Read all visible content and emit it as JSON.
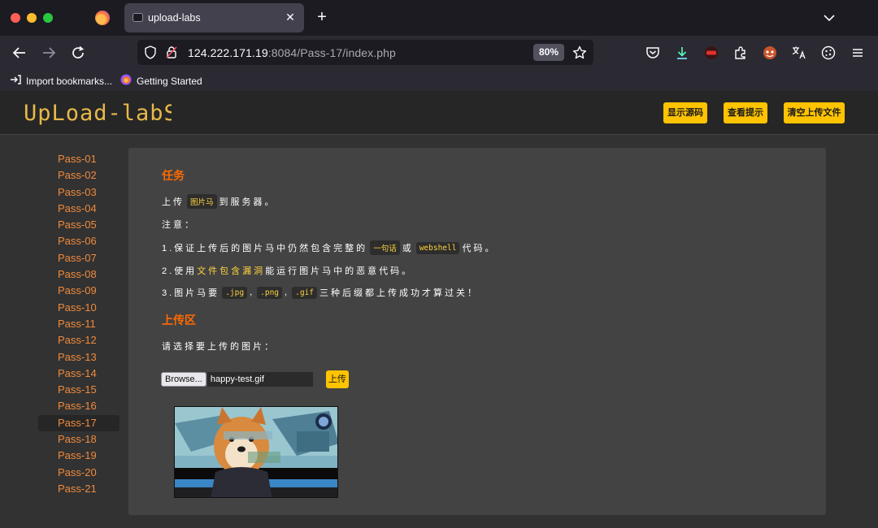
{
  "browser": {
    "tab_title": "upload-labs",
    "tab_close": "✕",
    "new_tab": "+",
    "url_host": "124.222.171.19",
    "url_rest": ":8084/Pass-17/index.php",
    "zoom": "80%",
    "bookmarks": [
      "Import bookmarks...",
      "Getting Started"
    ]
  },
  "header": {
    "logo_text": "UpLoad-labS",
    "buttons": [
      "显示源码",
      "查看提示",
      "清空上传文件"
    ]
  },
  "sidebar": {
    "items": [
      "Pass-01",
      "Pass-02",
      "Pass-03",
      "Pass-04",
      "Pass-05",
      "Pass-06",
      "Pass-07",
      "Pass-08",
      "Pass-09",
      "Pass-10",
      "Pass-11",
      "Pass-12",
      "Pass-13",
      "Pass-14",
      "Pass-15",
      "Pass-16",
      "Pass-17",
      "Pass-18",
      "Pass-19",
      "Pass-20",
      "Pass-21"
    ],
    "active": "Pass-17"
  },
  "task": {
    "title": "任务",
    "line1_pre": "上传",
    "line1_code": "图片马",
    "line1_post": "到服务器。",
    "note": "注意：",
    "item1_pre": "1.保证上传后的图片马中仍然包含完整的",
    "item1_code1": "一句话",
    "item1_mid": "或",
    "item1_code2": "webshell",
    "item1_post": "代码。",
    "item2_pre": "2.使用",
    "item2_hl": "文件包含漏洞",
    "item2_post": "能运行图片马中的恶意代码。",
    "item3_pre": "3.图片马要",
    "item3_code1": ".jpg",
    "item3_sep1": ",",
    "item3_code2": ".png",
    "item3_sep2": ",",
    "item3_code3": ".gif",
    "item3_post": "三种后缀都上传成功才算过关！"
  },
  "upload": {
    "title": "上传区",
    "prompt": "请选择要上传的图片：",
    "browse_label": "Browse...",
    "file_name": "happy-test.gif",
    "submit_label": "上传"
  },
  "colors": {
    "accent": "#ffc300",
    "title_orange": "#ff6a00",
    "link_orange": "#f08a3c",
    "code_yellow": "#ffd23f"
  }
}
